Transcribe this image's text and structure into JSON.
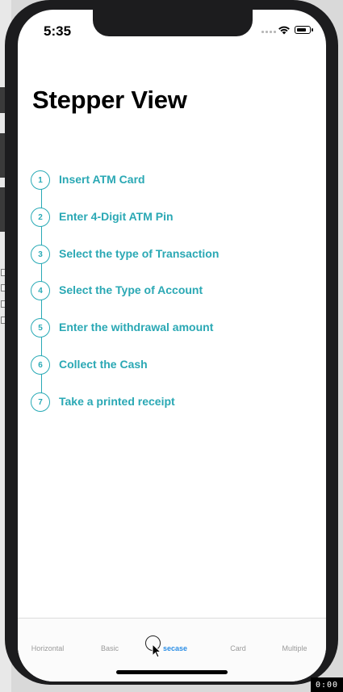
{
  "status_bar": {
    "time": "5:35"
  },
  "header": {
    "title": "Stepper View"
  },
  "stepper": {
    "accent_color": "#29aab6",
    "steps": [
      {
        "number": "1",
        "label": "Insert ATM Card"
      },
      {
        "number": "2",
        "label": "Enter 4-Digit ATM Pin"
      },
      {
        "number": "3",
        "label": "Select the type of Transaction"
      },
      {
        "number": "4",
        "label": "Select the Type of Account"
      },
      {
        "number": "5",
        "label": "Enter the withdrawal amount"
      },
      {
        "number": "6",
        "label": "Collect the Cash"
      },
      {
        "number": "7",
        "label": "Take a printed receipt"
      }
    ]
  },
  "tab_bar": {
    "active_color": "#2b8ee6",
    "tabs": [
      {
        "label": "Horizontal",
        "active": false
      },
      {
        "label": "Basic",
        "active": false
      },
      {
        "label": "secase",
        "active": true
      },
      {
        "label": "Card",
        "active": false
      },
      {
        "label": "Multiple",
        "active": false
      }
    ]
  },
  "overlay": {
    "timer": "0:00"
  }
}
